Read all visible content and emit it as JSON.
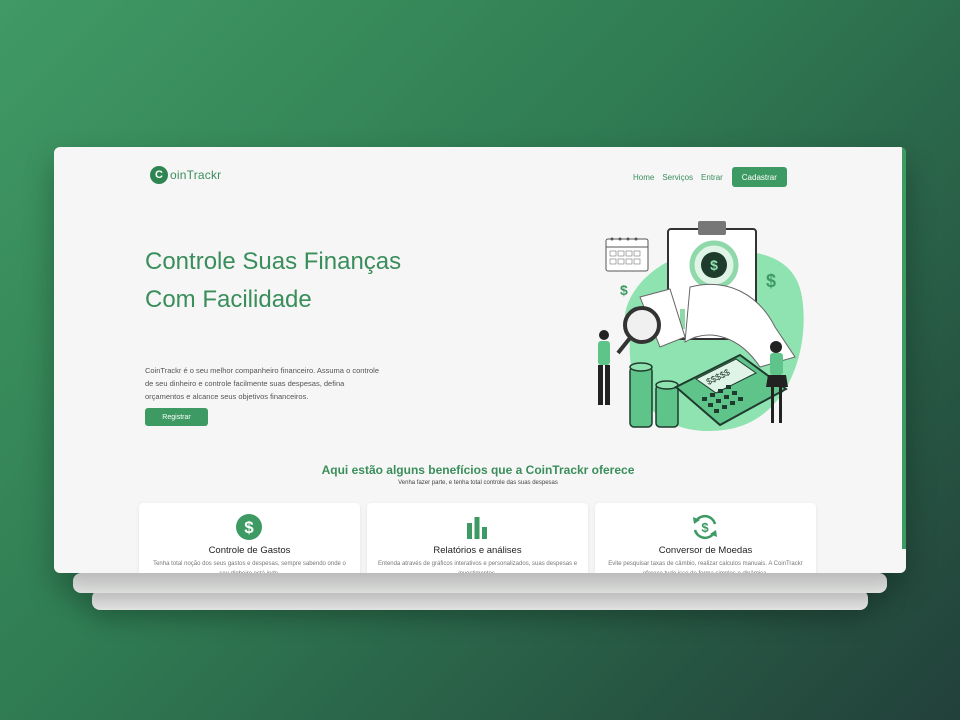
{
  "brand": {
    "logo_letter": "C",
    "name": "oinTrackr"
  },
  "nav": {
    "links": [
      "Home",
      "Serviços",
      "Entrar"
    ],
    "cta": "Cadastrar"
  },
  "hero": {
    "title": "Controle Suas Finanças Com Facilidade",
    "description": "CoinTrackr é o seu melhor companheiro financeiro. Assuma o controle de seu dinheiro e controle facilmente suas despesas, defina orçamentos e alcance seus objetivos financeiros.",
    "button": "Registrar",
    "calculator_display": "$$$$$"
  },
  "benefits": {
    "title": "Aqui estão alguns benefícios que a CoinTrackr oferece",
    "subtitle": "Venha fazer parte, e tenha total controle das suas despesas",
    "cards": [
      {
        "icon": "dollar-circle-icon",
        "title": "Controle de Gastos",
        "text": "Tenha total noção dos seus gastos e despesas, sempre sabendo onde o seu dinheiro está indo."
      },
      {
        "icon": "bar-chart-icon",
        "title": "Relatórios e análises",
        "text": "Entenda através de gráficos interativos e personalizados, suas despesas e investimentos."
      },
      {
        "icon": "currency-exchange-icon",
        "title": "Conversor de Moedas",
        "text": "Evite pesquisar taxas de câmbio, realizar calculos manuais. A CoinTrackr oferece tudo isso de forma simples e dinâmica."
      }
    ]
  },
  "colors": {
    "accent": "#3d9a62",
    "accent_dark": "#2f8552",
    "illustration_green": "#8fe3b0",
    "page_bg": "#f6f6f6"
  }
}
